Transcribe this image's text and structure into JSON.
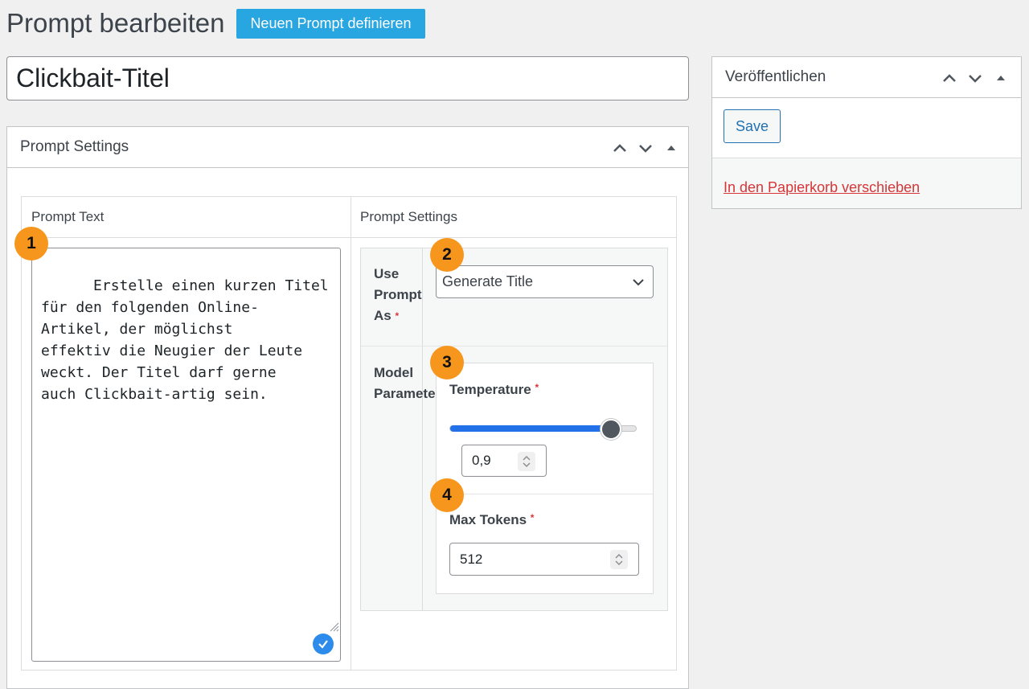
{
  "header": {
    "page_title": "Prompt bearbeiten",
    "new_button_label": "Neuen Prompt definieren"
  },
  "post_title": "Clickbait-Titel",
  "prompt_box": {
    "title": "Prompt Settings",
    "prompt_text_header": "Prompt Text",
    "prompt_settings_header": "Prompt Settings",
    "prompt_text": "Erstelle einen kurzen Titel\nfür den folgenden Online-\nArtikel, der möglichst\neffektiv die Neugier der Leute\nweckt. Der Titel darf gerne\nauch Clickbait-artig sein.",
    "use_prompt_as_label": "Use Prompt As",
    "use_prompt_as_value": "Generate Title",
    "model_parameters_label": "Model Parameters",
    "temperature_label": "Temperature",
    "temperature_value": "0,9",
    "temperature_slider_fraction": 0.86,
    "max_tokens_label": "Max Tokens",
    "max_tokens_value": "512",
    "required_mark": "*"
  },
  "publish_box": {
    "title": "Veröffentlichen",
    "save_label": "Save",
    "trash_link": "In den Papierkorb verschieben"
  },
  "markers": [
    "1",
    "2",
    "3",
    "4"
  ],
  "colors": {
    "accent_blue": "#27a6e1",
    "marker_orange": "#f7961d",
    "link_red": "#d63638",
    "slider_blue": "#2271e8"
  }
}
